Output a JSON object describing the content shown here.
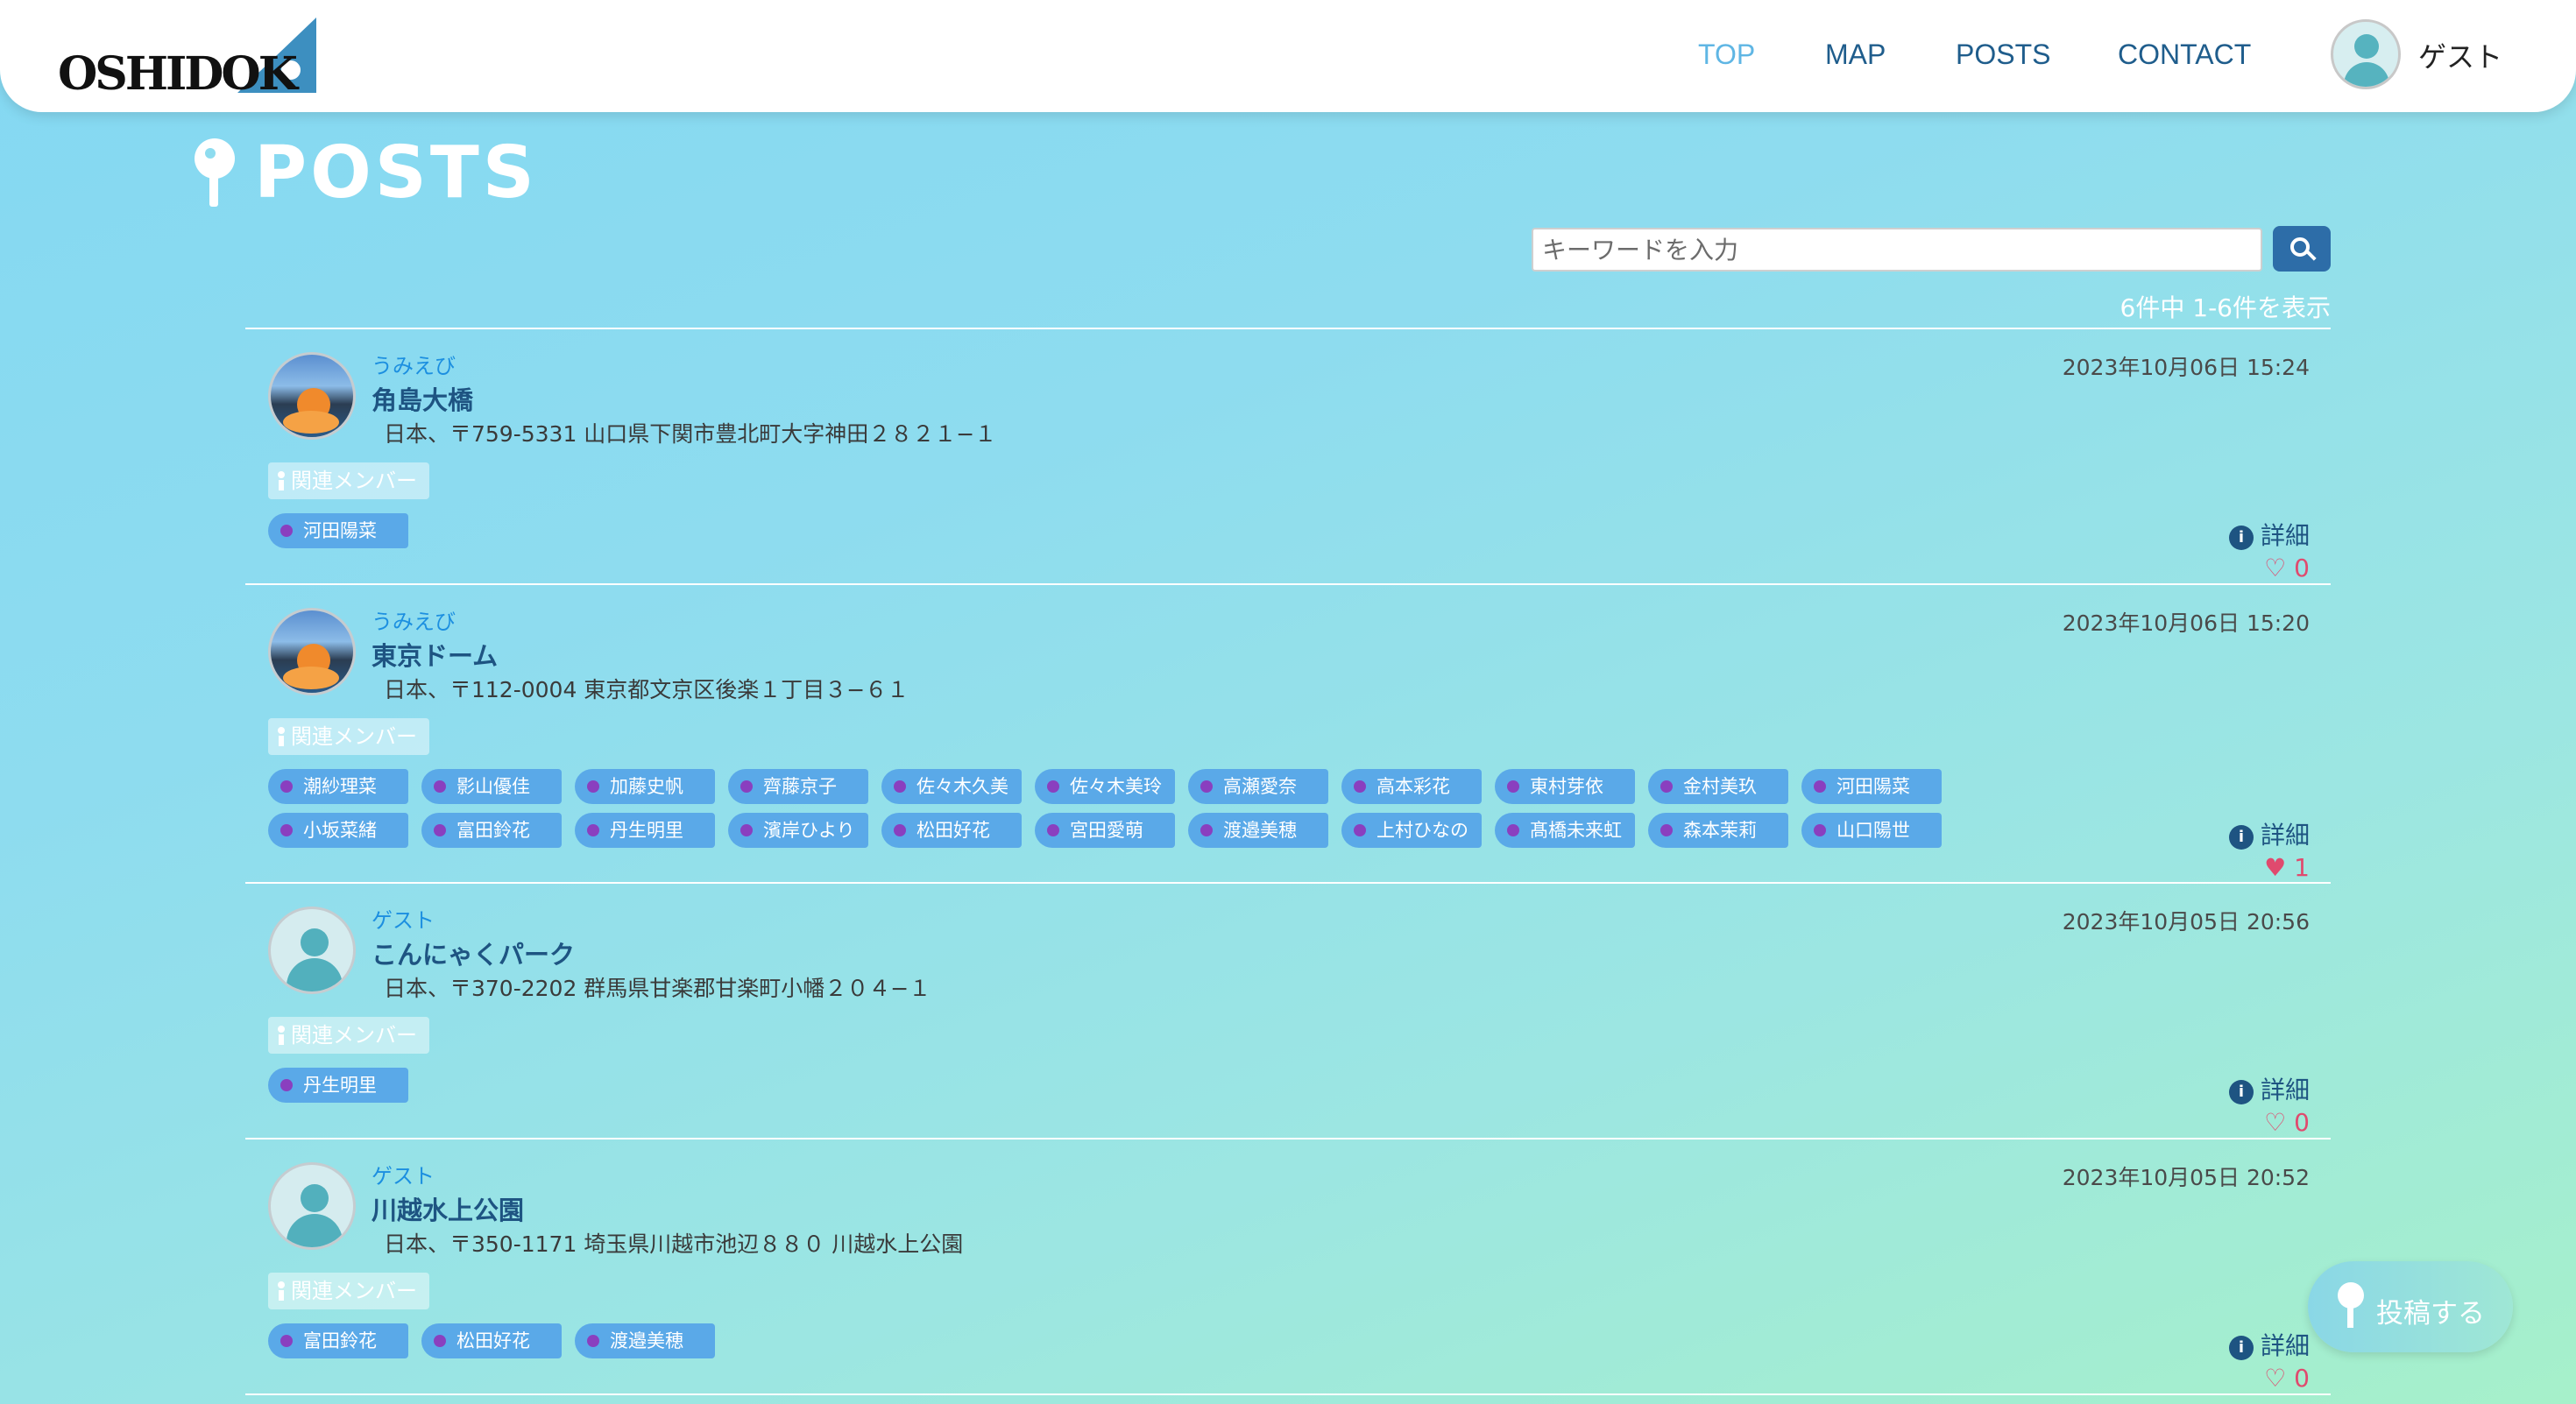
{
  "header": {
    "logo_text": "OSHIDOK",
    "nav": [
      "TOP",
      "MAP",
      "POSTS",
      "CONTACT"
    ],
    "active_nav": "TOP",
    "user_name": "ゲスト"
  },
  "page": {
    "title": "POSTS",
    "search_placeholder": "キーワードを入力",
    "count_text": "6件中 1-6件を表示"
  },
  "common": {
    "member_label": "関連メンバー",
    "detail_label": "詳細",
    "detail_icon": "i"
  },
  "posts": [
    {
      "author": "うみえび",
      "date": "2023年10月06日 15:24",
      "place": "角島大橋",
      "address": "日本、〒759-5331 山口県下関市豊北町大字神田２８２１−１",
      "members": [
        "河田陽菜"
      ],
      "likes": "0",
      "liked": false,
      "heart": "♡"
    },
    {
      "author": "うみえび",
      "date": "2023年10月06日 15:20",
      "place": "東京ドーム",
      "address": "日本、〒112-0004 東京都文京区後楽１丁目３−６１",
      "members": [
        "潮紗理菜",
        "影山優佳",
        "加藤史帆",
        "齊藤京子",
        "佐々木久美",
        "佐々木美玲",
        "高瀬愛奈",
        "高本彩花",
        "東村芽依",
        "金村美玖",
        "河田陽菜",
        "小坂菜緒",
        "富田鈴花",
        "丹生明里",
        "濱岸ひより",
        "松田好花",
        "宮田愛萌",
        "渡邉美穂",
        "上村ひなの",
        "髙橋未来虹",
        "森本茉莉",
        "山口陽世"
      ],
      "likes": "1",
      "liked": true,
      "heart": "♥"
    },
    {
      "author": "ゲスト",
      "date": "2023年10月05日 20:56",
      "place": "こんにゃくパーク",
      "address": "日本、〒370-2202 群馬県甘楽郡甘楽町小幡２０４−１",
      "members": [
        "丹生明里"
      ],
      "likes": "0",
      "liked": false,
      "heart": "♡"
    },
    {
      "author": "ゲスト",
      "date": "2023年10月05日 20:52",
      "place": "川越水上公園",
      "address": "日本、〒350-1171 埼玉県川越市池辺８８０ 川越水上公園",
      "members": [
        "富田鈴花",
        "松田好花",
        "渡邉美穂"
      ],
      "likes": "0",
      "liked": false,
      "heart": "♡"
    }
  ],
  "fab": {
    "label": "投稿する"
  },
  "colors": {
    "accent": "#2d6da8",
    "tag": "#5aa9e8",
    "tag_dot": "#8a3fbf",
    "like": "#e04a6e"
  }
}
